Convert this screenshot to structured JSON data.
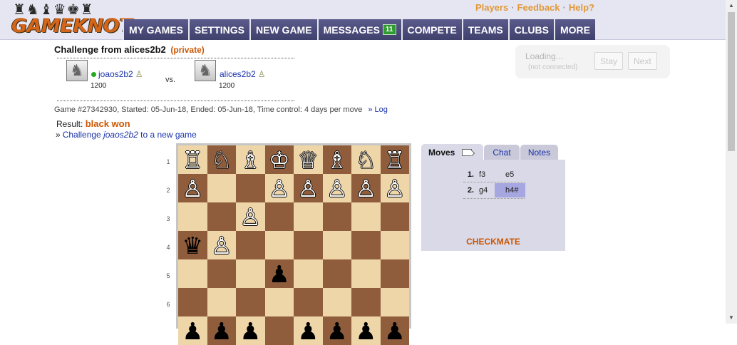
{
  "header": {
    "logo_pieces": "♜♞♝♛♚♜",
    "logo_text": "GAMEKNOT",
    "top_links": [
      "Players",
      "Feedback",
      "Help?"
    ],
    "nav": [
      {
        "label": "MY GAMES"
      },
      {
        "label": "SETTINGS"
      },
      {
        "label": "NEW GAME"
      },
      {
        "label": "MESSAGES",
        "badge": "11"
      },
      {
        "label": "COMPETE"
      },
      {
        "label": "TEAMS"
      },
      {
        "label": "CLUBS"
      },
      {
        "label": "MORE"
      }
    ]
  },
  "challenge": {
    "title": "Challenge from alices2b2",
    "privacy": "(private)",
    "vs": "vs.",
    "white": {
      "name": "joaos2b2",
      "rating": "1200",
      "online": true
    },
    "black": {
      "name": "alices2b2",
      "rating": "1200",
      "online": false
    }
  },
  "game": {
    "info": "Game #27342930, Started: 05-Jun-18, Ended: 05-Jun-18, Time control: 4 days per move",
    "log_link": "» Log",
    "result_label": "Result:",
    "result_value": "black won",
    "challenge_prefix": "Challenge",
    "challenge_user": "joaos2b2",
    "challenge_suffix": "to a new game"
  },
  "connection": {
    "loading": "Loading...",
    "status": "(not connected)",
    "stay_label": "Stay",
    "next_label": "Next"
  },
  "board": {
    "rank_labels": [
      "1",
      "2",
      "3",
      "4",
      "5",
      "6"
    ],
    "visible_rows": [
      [
        "R",
        "N",
        "B",
        "K",
        "Q",
        "B",
        "N",
        "R"
      ],
      [
        "P",
        "",
        "",
        "P",
        "P",
        "P",
        "P",
        "P"
      ],
      [
        "",
        "",
        "P",
        "",
        "",
        "",
        "",
        ""
      ],
      [
        "q",
        "P",
        "",
        "",
        "",
        "",
        "",
        ""
      ],
      [
        "",
        "",
        "",
        "p",
        "",
        "",
        "",
        ""
      ],
      [
        "",
        "",
        "",
        "",
        "",
        "",
        "",
        ""
      ],
      [
        "p",
        "p",
        "p",
        "",
        "p",
        "p",
        "p",
        "p"
      ]
    ],
    "piece_glyphs": {
      "K": "♔",
      "Q": "♕",
      "R": "♖",
      "B": "♗",
      "N": "♘",
      "P": "♙",
      "k": "♚",
      "q": "♛",
      "r": "♜",
      "b": "♝",
      "n": "♞",
      "p": "♟"
    },
    "light_color": "#efd6a9",
    "dark_color": "#8f5d3c"
  },
  "moves_panel": {
    "tabs": [
      "Moves",
      "Chat",
      "Notes"
    ],
    "active_tab": "Moves",
    "moves": [
      {
        "num": "1.",
        "white": "f3",
        "black": "e5"
      },
      {
        "num": "2.",
        "white": "g4",
        "black": "h4#",
        "highlight": true
      }
    ],
    "status": "CHECKMATE"
  },
  "colors": {
    "accent_orange": "#cc5500",
    "nav_bg": "#4a4a7a",
    "link_blue": "#1a33aa",
    "badge_green": "#2e9b2e"
  }
}
